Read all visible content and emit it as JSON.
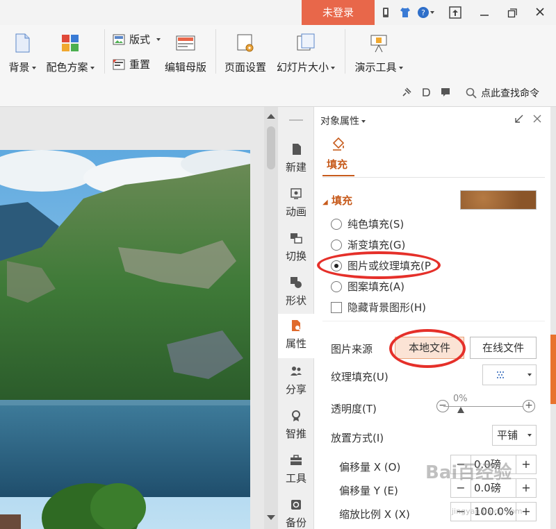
{
  "titlebar": {
    "login_label": "未登录",
    "icons": [
      "phone-icon",
      "shirt-icon",
      "help-icon",
      "upload-icon"
    ],
    "window_controls": [
      "minimize",
      "restore",
      "close"
    ]
  },
  "ribbon": {
    "background_label": "背景",
    "color_scheme_label": "配色方案",
    "layout_label": "版式",
    "reset_label": "重置",
    "edit_master_label": "编辑母版",
    "page_setup_label": "页面设置",
    "slide_size_label": "幻灯片大小",
    "present_tools_label": "演示工具",
    "search_cmd_label": "点此查找命令"
  },
  "rail": {
    "items": [
      {
        "label": "新建",
        "icon": "new-page-icon"
      },
      {
        "label": "动画",
        "icon": "animation-icon"
      },
      {
        "label": "切换",
        "icon": "transition-icon"
      },
      {
        "label": "形状",
        "icon": "shape-icon"
      },
      {
        "label": "属性",
        "icon": "property-icon"
      },
      {
        "label": "分享",
        "icon": "share-icon"
      },
      {
        "label": "智推",
        "icon": "recommend-icon"
      },
      {
        "label": "工具",
        "icon": "toolbox-icon"
      },
      {
        "label": "备份",
        "icon": "backup-icon"
      }
    ],
    "active_index": 4
  },
  "panel": {
    "title": "对象属性",
    "tab_label": "填充",
    "section_title": "填充",
    "fill_options": [
      {
        "label": "纯色填充(S)",
        "checked": false
      },
      {
        "label": "渐变填充(G)",
        "checked": false
      },
      {
        "label": "图片或纹理填充(P",
        "checked": true
      },
      {
        "label": "图案填充(A)",
        "checked": false
      }
    ],
    "hide_bg_label": "隐藏背景图形(H)",
    "image_source_label": "图片来源",
    "local_file_label": "本地文件",
    "online_file_label": "在线文件",
    "texture_fill_label": "纹理填充(U)",
    "transparency_label": "透明度(T)",
    "transparency_value": "0%",
    "placement_label": "放置方式(I)",
    "placement_value": "平铺",
    "offset_x_label": "偏移量 X (O)",
    "offset_x_value": "0.0磅",
    "offset_y_label": "偏移量 Y (E)",
    "offset_y_value": "0.0磅",
    "scale_x_label": "缩放比例 X (X)",
    "scale_x_value": "100.0%"
  },
  "watermark": {
    "text": "Bai百经验",
    "sub": "jingyan.baidu.com"
  },
  "colors": {
    "accent": "#c75b1c",
    "login_bg": "#e8674a",
    "annotation": "#e5302a"
  }
}
